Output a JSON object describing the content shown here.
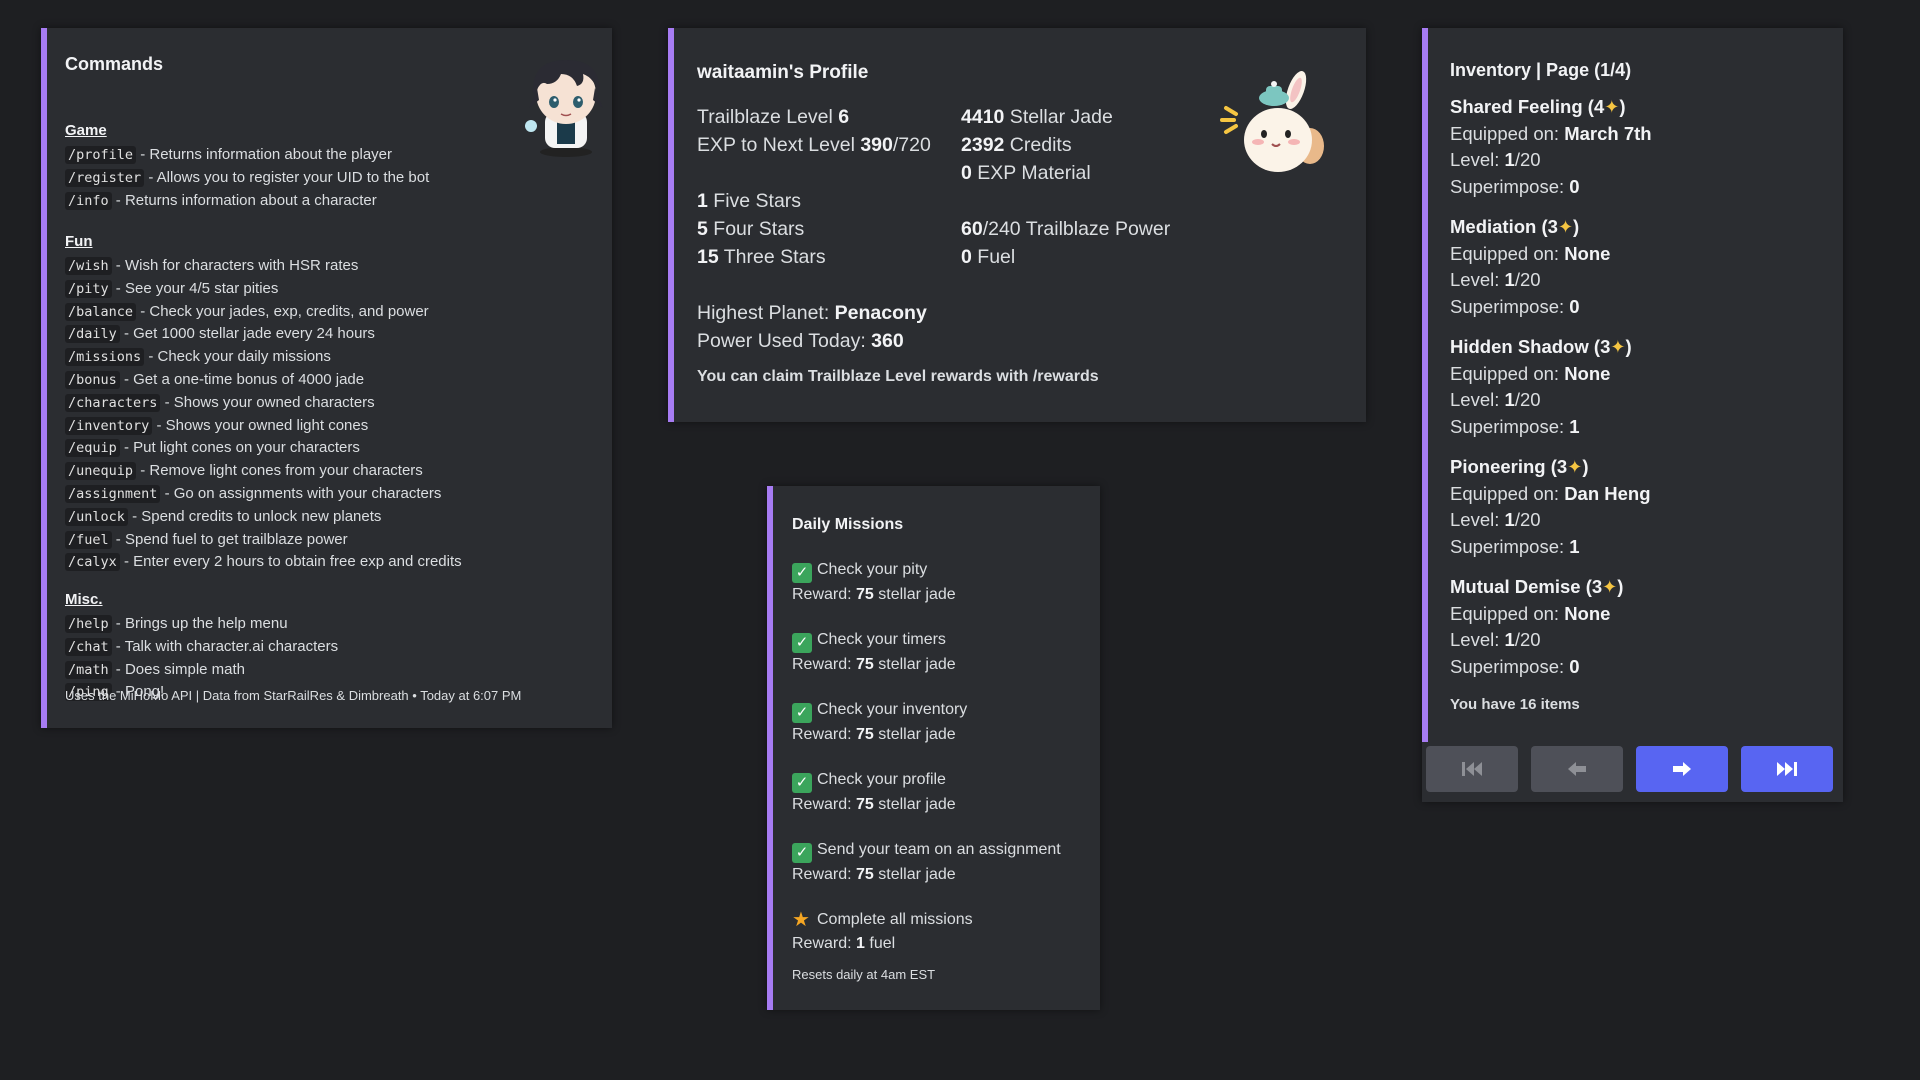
{
  "colors": {
    "accent_bar": "#a77cf3",
    "button_blue": "#5865f2",
    "button_grey": "#4e5058"
  },
  "commands": {
    "title": "Commands",
    "avatar_icon": "chibi-character-avatar",
    "sections": [
      {
        "heading": "Game",
        "items": [
          {
            "cmd": "/profile",
            "desc": " - Returns information about the player"
          },
          {
            "cmd": "/register",
            "desc": " - Allows you to register your UID to the bot"
          },
          {
            "cmd": "/info",
            "desc": " - Returns information about a character"
          }
        ]
      },
      {
        "heading": "Fun",
        "items": [
          {
            "cmd": "/wish",
            "desc": " - Wish for characters with HSR rates"
          },
          {
            "cmd": "/pity",
            "desc": " - See your 4/5 star pities"
          },
          {
            "cmd": "/balance",
            "desc": " - Check your jades, exp, credits, and power"
          },
          {
            "cmd": "/daily",
            "desc": " - Get 1000 stellar jade every 24 hours"
          },
          {
            "cmd": "/missions",
            "desc": " - Check your daily missions"
          },
          {
            "cmd": "/bonus",
            "desc": " - Get a one-time bonus of 4000 jade"
          },
          {
            "cmd": "/characters",
            "desc": " - Shows your owned characters"
          },
          {
            "cmd": "/inventory",
            "desc": " - Shows your owned light cones"
          },
          {
            "cmd": "/equip",
            "desc": " - Put light cones on your characters"
          },
          {
            "cmd": "/unequip",
            "desc": " - Remove light cones from your characters"
          },
          {
            "cmd": "/assignment",
            "desc": " - Go on assignments with your characters"
          },
          {
            "cmd": "/unlock",
            "desc": " - Spend credits to unlock new planets"
          },
          {
            "cmd": "/fuel",
            "desc": " - Spend fuel to get trailblaze power"
          },
          {
            "cmd": "/calyx",
            "desc": " - Enter every 2 hours to obtain free exp and credits"
          }
        ]
      },
      {
        "heading": "Misc.",
        "items": [
          {
            "cmd": "/help",
            "desc": " - Brings up the help menu"
          },
          {
            "cmd": "/chat",
            "desc": " - Talk with character.ai characters"
          },
          {
            "cmd": "/math",
            "desc": " - Does simple math"
          },
          {
            "cmd": "/ping",
            "desc": " - Pong!"
          }
        ]
      }
    ],
    "footer": "Uses the MiHoMo API | Data from StarRailRes & Dimbreath • Today at 6:07 PM"
  },
  "profile": {
    "title": "waitaamin's Profile",
    "thumb_icon": "bunny-mascot-icon",
    "trailblaze_level_label": "Trailblaze Level ",
    "trailblaze_level": "6",
    "exp_label": "EXP to Next Level ",
    "exp_current": "390",
    "exp_max": "/720",
    "stellar_jade": "4410",
    "stellar_jade_label": " Stellar Jade",
    "credits": "2392",
    "credits_label": " Credits",
    "exp_material": "0",
    "exp_material_label": " EXP Material",
    "five_stars": "1",
    "five_stars_label": " Five Stars",
    "four_stars": "5",
    "four_stars_label": " Four Stars",
    "three_stars": "15",
    "three_stars_label": " Three Stars",
    "power_current": "60",
    "power_label": "/240 Trailblaze Power",
    "fuel": "0",
    "fuel_label": " Fuel",
    "planet_label": "Highest Planet: ",
    "planet": "Penacony",
    "power_used_label": "Power Used Today: ",
    "power_used": "360",
    "note": "You can claim Trailblaze Level rewards with /rewards"
  },
  "missions": {
    "title": "Daily Missions",
    "reward_label": "Reward: ",
    "items": [
      {
        "icon": "check-icon",
        "name": "Check your pity",
        "reward_value": "75",
        "reward_unit": " stellar jade"
      },
      {
        "icon": "check-icon",
        "name": "Check your timers",
        "reward_value": "75",
        "reward_unit": " stellar jade"
      },
      {
        "icon": "check-icon",
        "name": "Check your inventory",
        "reward_value": "75",
        "reward_unit": " stellar jade"
      },
      {
        "icon": "check-icon",
        "name": "Check your profile",
        "reward_value": "75",
        "reward_unit": " stellar jade"
      },
      {
        "icon": "check-icon",
        "name": "Send your team on an assignment",
        "reward_value": "75",
        "reward_unit": " stellar jade"
      },
      {
        "icon": "star-icon",
        "name": "Complete all missions",
        "reward_value": "1",
        "reward_unit": " fuel"
      }
    ],
    "footer": "Resets daily at 4am EST"
  },
  "inventory": {
    "title": "Inventory | Page (1/4)",
    "equipped_label": "Equipped on: ",
    "level_label": "Level: ",
    "superimpose_label": "Superimpose: ",
    "items": [
      {
        "name": "Shared Feeling",
        "rarity": "4",
        "equipped": "March 7th",
        "level": "1",
        "level_max": "/20",
        "superimpose": "0"
      },
      {
        "name": "Mediation",
        "rarity": "3",
        "equipped": "None",
        "level": "1",
        "level_max": "/20",
        "superimpose": "0"
      },
      {
        "name": "Hidden Shadow",
        "rarity": "3",
        "equipped": "None",
        "level": "1",
        "level_max": "/20",
        "superimpose": "1"
      },
      {
        "name": "Pioneering",
        "rarity": "3",
        "equipped": "Dan Heng",
        "level": "1",
        "level_max": "/20",
        "superimpose": "1"
      },
      {
        "name": "Mutual Demise",
        "rarity": "3",
        "equipped": "None",
        "level": "1",
        "level_max": "/20",
        "superimpose": "0"
      }
    ],
    "footer": "You have 16 items",
    "buttons": [
      {
        "icon": "first-page-icon",
        "style": "grey"
      },
      {
        "icon": "previous-page-icon",
        "style": "grey"
      },
      {
        "icon": "next-page-icon",
        "style": "blue"
      },
      {
        "icon": "last-page-icon",
        "style": "blue"
      }
    ]
  }
}
